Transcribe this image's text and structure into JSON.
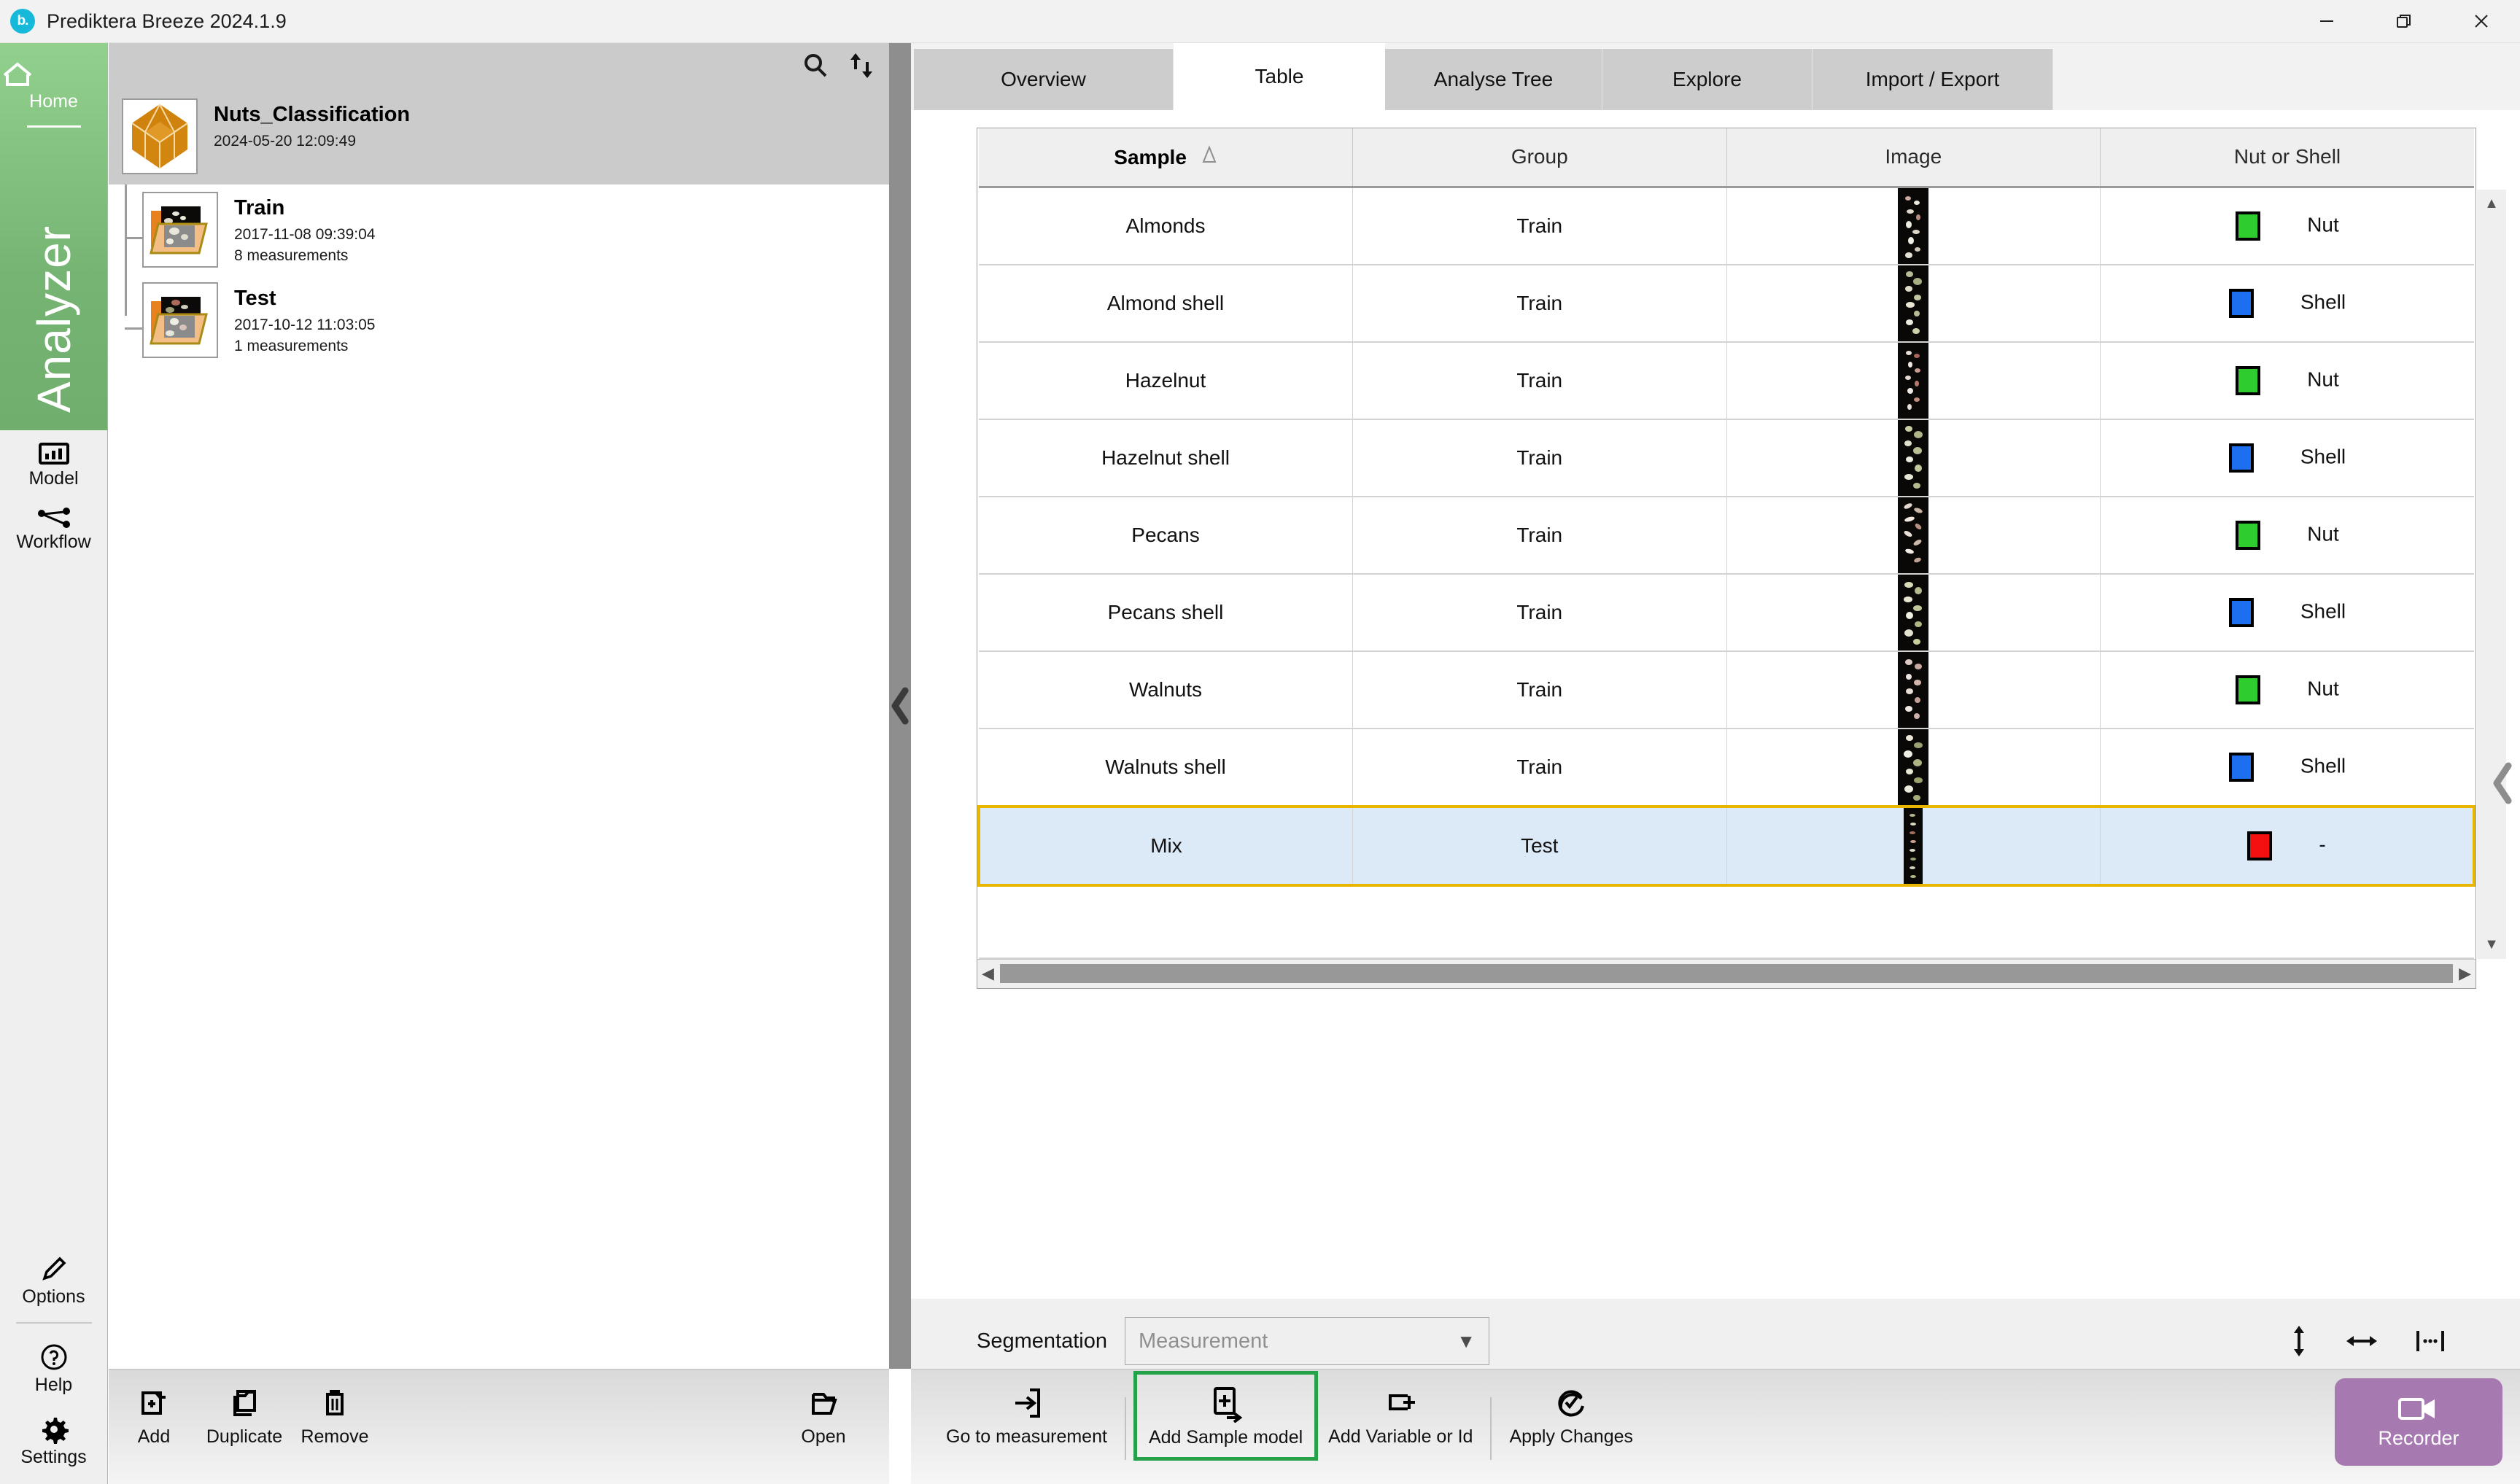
{
  "window": {
    "title": "Prediktera Breeze 2024.1.9",
    "logo_text": "b.",
    "minimize": "—",
    "restore": "❐",
    "close": "✕"
  },
  "rail": {
    "home": {
      "label": "Home",
      "icon": "home-icon"
    },
    "product": "Analyzer",
    "items": [
      {
        "label": "Model",
        "icon": "model-icon"
      },
      {
        "label": "Workflow",
        "icon": "workflow-icon"
      }
    ],
    "bottom": [
      {
        "label": "Options",
        "icon": "pencil-icon"
      },
      {
        "label": "Help",
        "icon": "question-circle-icon"
      },
      {
        "label": "Settings",
        "icon": "gear-icon"
      }
    ]
  },
  "project_panel": {
    "header_icons": [
      "search-icon",
      "sort-icon"
    ],
    "root": {
      "title": "Nuts_Classification",
      "timestamp": "2024-05-20 12:09:49",
      "icon": "cube-icon"
    },
    "children": [
      {
        "title": "Train",
        "timestamp": "2017-11-08 09:39:04",
        "measurements": "8 measurements"
      },
      {
        "title": "Test",
        "timestamp": "2017-10-12 11:03:05",
        "measurements": "1 measurements"
      }
    ],
    "toolbar": [
      {
        "label": "Add",
        "icon": "folder-plus-icon"
      },
      {
        "label": "Duplicate",
        "icon": "folder-copy-icon"
      },
      {
        "label": "Remove",
        "icon": "trash-icon"
      }
    ],
    "toolbar_right": {
      "label": "Open",
      "icon": "folder-open-icon"
    }
  },
  "splitter": {
    "collapse_icon": "chevron-left-icon",
    "expand_icon": "chevron-right-icon"
  },
  "right_edge": {
    "collapse_icon": "chevron-left-icon"
  },
  "tabs": [
    {
      "label": "Overview",
      "active": false
    },
    {
      "label": "Table",
      "active": true
    },
    {
      "label": "Analyse Tree",
      "active": false
    },
    {
      "label": "Explore",
      "active": false
    },
    {
      "label": "Import / Export",
      "active": false
    }
  ],
  "table": {
    "columns": [
      "Sample",
      "Group",
      "Image",
      "Nut or Shell"
    ],
    "sort_column": "Sample",
    "sort_indicator": "ascending",
    "rows": [
      {
        "sample": "Almonds",
        "group": "Train",
        "image": "thumbnail",
        "color": "#2ecc2e",
        "label": "Nut",
        "selected": false
      },
      {
        "sample": "Almond shell",
        "group": "Train",
        "image": "thumbnail",
        "color": "#1e6ff0",
        "label": "Shell",
        "selected": false
      },
      {
        "sample": "Hazelnut",
        "group": "Train",
        "image": "thumbnail",
        "color": "#2ecc2e",
        "label": "Nut",
        "selected": false
      },
      {
        "sample": "Hazelnut shell",
        "group": "Train",
        "image": "thumbnail",
        "color": "#1e6ff0",
        "label": "Shell",
        "selected": false
      },
      {
        "sample": "Pecans",
        "group": "Train",
        "image": "thumbnail",
        "color": "#2ecc2e",
        "label": "Nut",
        "selected": false
      },
      {
        "sample": "Pecans shell",
        "group": "Train",
        "image": "thumbnail",
        "color": "#1e6ff0",
        "label": "Shell",
        "selected": false
      },
      {
        "sample": "Walnuts",
        "group": "Train",
        "image": "thumbnail",
        "color": "#2ecc2e",
        "label": "Nut",
        "selected": false
      },
      {
        "sample": "Walnuts shell",
        "group": "Train",
        "image": "thumbnail",
        "color": "#1e6ff0",
        "label": "Shell",
        "selected": false
      },
      {
        "sample": "Mix",
        "group": "Test",
        "image": "thumbnail",
        "color": "#f41010",
        "label": "-",
        "selected": true
      }
    ],
    "selection_border_color": "#e8b600",
    "selection_row_color": "#dce9f7"
  },
  "segmentation": {
    "label": "Segmentation",
    "value": "Measurement",
    "caret": "▼",
    "icons": [
      "resize-vertical-icon",
      "resize-horizontal-icon",
      "fit-width-icon"
    ]
  },
  "main_toolbar": [
    {
      "label": "Go to measurement",
      "icon": "go-to-measurement-icon",
      "highlighted": false
    },
    {
      "label": "Add Sample model",
      "icon": "add-sample-model-icon",
      "highlighted": true
    },
    {
      "label": "Add Variable or Id",
      "icon": "add-variable-icon",
      "highlighted": false
    },
    {
      "label": "Apply Changes",
      "icon": "apply-changes-icon",
      "highlighted": false
    }
  ],
  "recorder": {
    "label": "Recorder",
    "icon": "video-camera-icon",
    "color": "#a679b0"
  }
}
